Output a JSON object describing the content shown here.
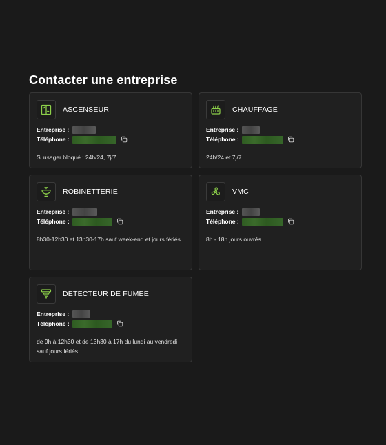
{
  "page": {
    "title": "Contacter une entreprise"
  },
  "labels": {
    "company": "Entreprise : ",
    "phone": "Téléphone : "
  },
  "colors": {
    "background": "#1a1a1a",
    "card": "#202020",
    "accent": "#8dd04a"
  },
  "cards": [
    {
      "title": "ASCENSEUR",
      "icon": "elevator-icon",
      "hours": "Si usager bloqué : 24h/24, 7j/7."
    },
    {
      "title": "CHAUFFAGE",
      "icon": "heater-icon",
      "hours": "24h/24 et 7j/7"
    },
    {
      "title": "ROBINETTERIE",
      "icon": "faucet-icon",
      "hours": "8h30-12h30 et 13h30-17h sauf week-end et jours fériés."
    },
    {
      "title": "VMC",
      "icon": "fan-icon",
      "hours": "8h - 18h jours ouvrés."
    },
    {
      "title": "DETECTEUR DE FUMEE",
      "icon": "smoke-detector-icon",
      "hours": "de 9h à 12h30 et de 13h30 à 17h du lundi au vendredi sauf jours fériés"
    }
  ]
}
